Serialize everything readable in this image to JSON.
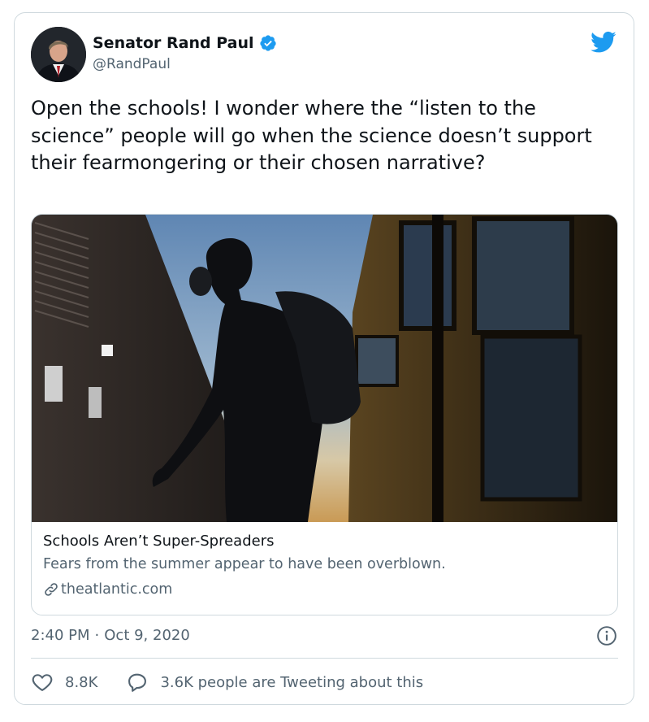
{
  "author": {
    "display_name": "Senator Rand Paul",
    "handle": "@RandPaul",
    "verified": true,
    "avatar_icon": "person-in-suit-avatar"
  },
  "tweet": {
    "text": "Open the schools! I wonder where the “listen to the science” people will go when the science doesn’t support their fearmongering or their chosen narrative?"
  },
  "link_card": {
    "image_description_icon": "student-with-backpack-next-to-school-bus-photo",
    "title": "Schools Aren’t Super-Spreaders",
    "description": "Fears from the summer appear to have been overblown.",
    "domain": "theatlantic.com"
  },
  "meta": {
    "time": "2:40 PM",
    "separator": "·",
    "date": "Oct 9, 2020"
  },
  "actions": {
    "like_count": "8.8K",
    "reply_text": "3.6K people are Tweeting about this"
  },
  "colors": {
    "brand_blue": "#1d9bf0",
    "text_primary": "#0f1419",
    "text_secondary": "#536471",
    "border": "#cfd9de"
  }
}
